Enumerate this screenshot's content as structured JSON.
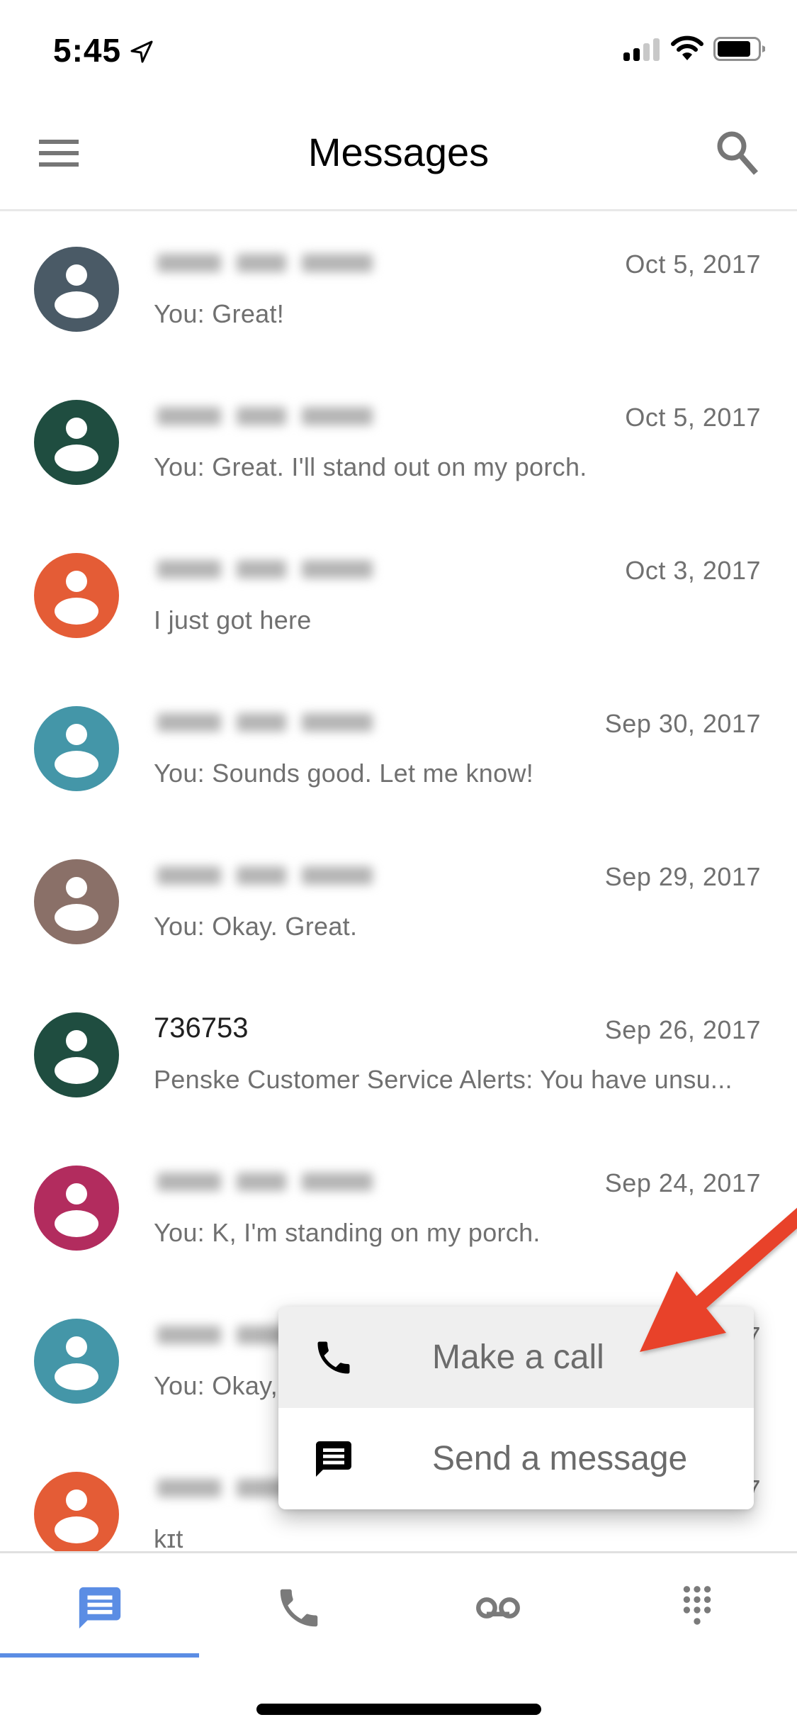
{
  "status_bar": {
    "time": "5:45",
    "location_icon": "location-arrow-icon",
    "signal_bars_active": 2,
    "signal_bars_total": 4,
    "wifi_icon": "wifi-icon",
    "battery_level": 0.8
  },
  "header": {
    "title": "Messages",
    "menu_icon": "hamburger-menu-icon",
    "search_icon": "search-icon"
  },
  "conversations": [
    {
      "name": "",
      "name_blurred": true,
      "date": "Oct 5, 2017",
      "preview": "You: Great!",
      "avatar_color": "#4a5a66"
    },
    {
      "name": "",
      "name_blurred": true,
      "date": "Oct 5, 2017",
      "preview": "You: Great. I'll stand out on my porch.",
      "avatar_color": "#1f4d40"
    },
    {
      "name": "",
      "name_blurred": true,
      "date": "Oct 3, 2017",
      "preview": "I just got here",
      "avatar_color": "#e45c36"
    },
    {
      "name": "",
      "name_blurred": true,
      "date": "Sep 30, 2017",
      "preview": "You: Sounds good. Let me know!",
      "avatar_color": "#4496a8"
    },
    {
      "name": "",
      "name_blurred": true,
      "date": "Sep 29, 2017",
      "preview": "You: Okay. Great.",
      "avatar_color": "#8a7068"
    },
    {
      "name": "736753",
      "name_blurred": false,
      "date": "Sep 26, 2017",
      "preview": "Penske Customer Service Alerts: You have unsu...",
      "avatar_color": "#1f4d40"
    },
    {
      "name": "",
      "name_blurred": true,
      "date": "Sep 24, 2017",
      "preview": "You: K, I'm standing on my porch.",
      "avatar_color": "#b22c5e"
    },
    {
      "name": "",
      "name_blurred": true,
      "date": "7",
      "preview": "You: Okay,",
      "avatar_color": "#4496a8"
    },
    {
      "name": "",
      "name_blurred": true,
      "date": "7",
      "preview": "kɪt",
      "avatar_color": "#e45c36"
    }
  ],
  "popup_menu": {
    "items": [
      {
        "label": "Make a call",
        "icon": "phone-icon",
        "highlighted": true
      },
      {
        "label": "Send a message",
        "icon": "message-icon",
        "highlighted": false
      }
    ]
  },
  "annotation": {
    "type": "arrow",
    "color": "#e8432a",
    "points_to": "Make a call"
  },
  "bottom_nav": {
    "accent_color": "#5b8de4",
    "inactive_color": "#7a7a7a",
    "tabs": [
      {
        "id": "messages",
        "icon": "message-icon",
        "active": true
      },
      {
        "id": "calls",
        "icon": "phone-icon",
        "active": false
      },
      {
        "id": "voicemail",
        "icon": "voicemail-icon",
        "active": false
      },
      {
        "id": "dialpad",
        "icon": "dialpad-icon",
        "active": false
      }
    ]
  }
}
